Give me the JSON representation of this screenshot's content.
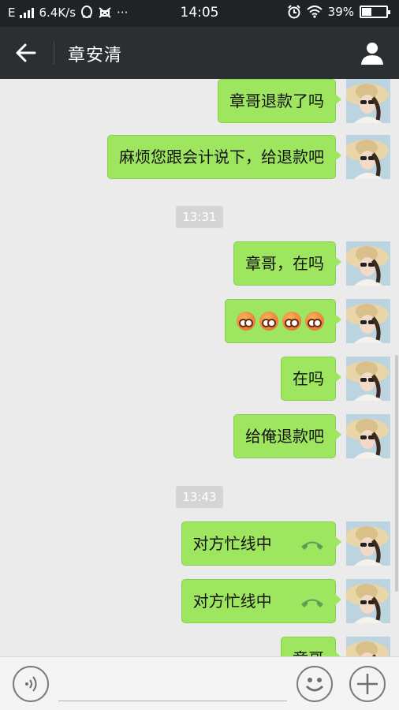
{
  "status_bar": {
    "network_type": "E",
    "speed": "6.4K/s",
    "time": "14:05",
    "battery_percent": "39%",
    "battery_level": 0.39,
    "icons": [
      "signal-icon",
      "qq-icon",
      "android-debug-icon",
      "more-icon",
      "alarm-icon",
      "wifi-icon",
      "battery-icon"
    ]
  },
  "header": {
    "title": "章安清",
    "icons": [
      "back-arrow-icon",
      "contact-profile-icon"
    ]
  },
  "messages": [
    {
      "type": "text",
      "text": "章哥退款了吗"
    },
    {
      "type": "text",
      "text": "麻烦您跟会计说下，给退款吧"
    },
    {
      "type": "timestamp",
      "text": "13:31"
    },
    {
      "type": "text",
      "text": "章哥，在吗"
    },
    {
      "type": "emoji",
      "count": 4,
      "icon": "flushed-face-emoji"
    },
    {
      "type": "text",
      "text": "在吗"
    },
    {
      "type": "text",
      "text": "给俺退款吧"
    },
    {
      "type": "timestamp",
      "text": "13:43"
    },
    {
      "type": "call",
      "text": "对方忙线中",
      "icon": "phone-icon"
    },
    {
      "type": "call",
      "text": "对方忙线中",
      "icon": "phone-icon"
    },
    {
      "type": "text",
      "text": "章哥"
    }
  ],
  "input_bar": {
    "icons": [
      "voice-icon",
      "emoji-smile-icon",
      "plus-icon"
    ]
  },
  "colors": {
    "bubble": "#9ee65f",
    "header": "#2b2f32",
    "statusbar": "#1f2326",
    "chat_bg": "#ebebeb"
  }
}
